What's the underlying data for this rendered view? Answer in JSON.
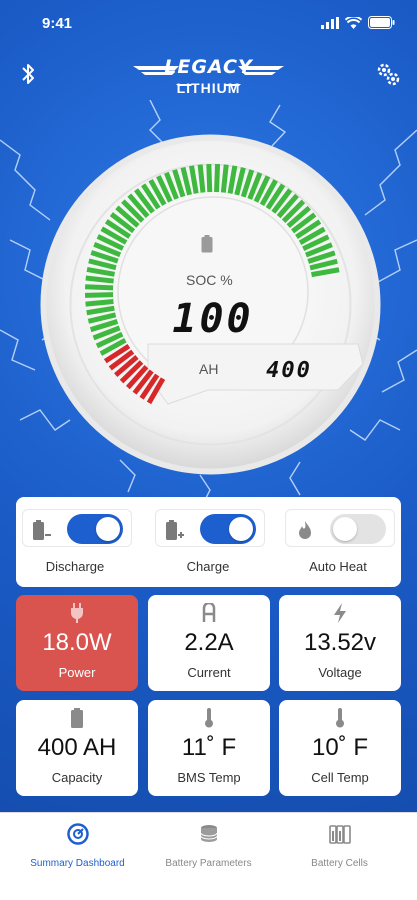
{
  "status_bar": {
    "time": "9:41"
  },
  "header": {
    "brand": "LEGACY",
    "brand_sub": "LITHIUM"
  },
  "gauge": {
    "soc_label": "SOC %",
    "soc_value": "100",
    "ah_label": "AH",
    "ah_value": "400",
    "green_color": "#3fb83f",
    "red_color": "#d62828"
  },
  "toggles": [
    {
      "label": "Discharge",
      "icon": "battery-minus-icon",
      "state": "on"
    },
    {
      "label": "Charge",
      "icon": "battery-plus-icon",
      "state": "on"
    },
    {
      "label": "Auto Heat",
      "icon": "flame-icon",
      "state": "off"
    }
  ],
  "tiles": [
    {
      "value": "18.0W",
      "label": "Power",
      "icon": "plug-icon",
      "alert": true
    },
    {
      "value": "2.2A",
      "label": "Current",
      "icon": "ampere-icon",
      "alert": false
    },
    {
      "value": "13.52v",
      "label": "Voltage",
      "icon": "bolt-icon",
      "alert": false
    },
    {
      "value": "400 AH",
      "label": "Capacity",
      "icon": "battery-icon",
      "alert": false
    },
    {
      "value": "11˚ F",
      "label": "BMS Temp",
      "icon": "thermometer-icon",
      "alert": false
    },
    {
      "value": "10˚ F",
      "label": "Cell Temp",
      "icon": "thermometer-icon",
      "alert": false
    }
  ],
  "nav": [
    {
      "label": "Summary Dashboard",
      "icon": "dashboard-icon",
      "active": true
    },
    {
      "label": "Battery Parameters",
      "icon": "parameters-icon",
      "active": false
    },
    {
      "label": "Battery Cells",
      "icon": "cells-icon",
      "active": false
    }
  ],
  "colors": {
    "accent": "#1e5fd0",
    "alert": "#d9534f",
    "background": "#1b5cc8"
  }
}
